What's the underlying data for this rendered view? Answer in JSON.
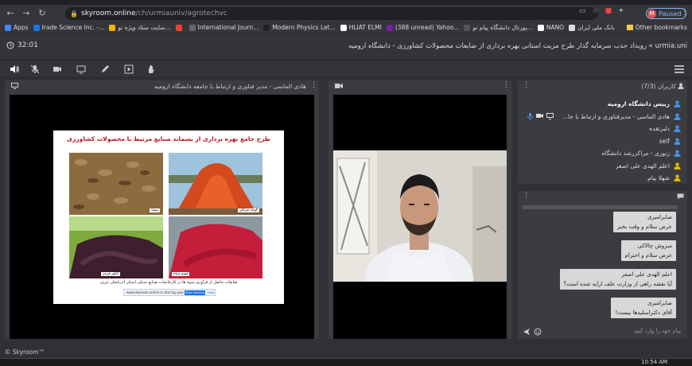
{
  "browser": {
    "url_host": "skyroom.online",
    "url_path": "/ch/urmiauniv/agrotechvc",
    "profile_initial": "M",
    "profile_label": "Paused"
  },
  "bookmarks": {
    "items": [
      {
        "label": "Apps",
        "color": "#4285f4"
      },
      {
        "label": "Irade Science Inc. -...",
        "color": "#1a73e8"
      },
      {
        "label": "سایت ستاد ویژه تو...",
        "color": "#f4b400"
      },
      {
        "label": "",
        "color": "#ea4335"
      },
      {
        "label": "International Journ...",
        "color": "#666"
      },
      {
        "label": "Modern Physics Let...",
        "color": "#222"
      },
      {
        "label": "HLIAT ELMI",
        "color": "#fff"
      },
      {
        "label": "(388 unread) Yahoo...",
        "color": "#7b1fa2"
      },
      {
        "label": "پورتال دانشگاه پیام نو...",
        "color": "#555"
      },
      {
        "label": "NANO",
        "color": "#fff"
      },
      {
        "label": "بانک ملی ایران",
        "color": "#ddd"
      }
    ],
    "other": "Other bookmarks"
  },
  "header": {
    "timer": "32:01",
    "title": "urmia.uni » رویداد جذب سرمایه گذار طرح مزیت استانی بهره برداری از ضایعات محصولات کشاورزی - دانشگاه ارومیه"
  },
  "main_panel": {
    "title": "هادی الماسی - مدیر فناوری و ارتباط با جامعه دانشگاه ارومیه",
    "slide": {
      "title": "طرح جامع بهره برداری از پسماند صنایع مرتبط با محصولات کشاورزی",
      "photos": [
        {
          "caption": "پسته"
        },
        {
          "caption": "گوجه فرنگی"
        },
        {
          "caption": "انگور قرمز"
        },
        {
          "caption": "فوتو سیاه"
        }
      ],
      "caption": "ضایعات حاصل از فرآوری میوه ها در کارخانجات صنایع تبدیلی استان آذربایجان غربی",
      "share_text": "www.skyroom.online is sharing your screen.",
      "share_button": "Stop sharing",
      "share_hide": "Hide"
    }
  },
  "users_panel": {
    "title": "کاربران (7/3)",
    "users": [
      {
        "name": "رییس دانشگاه ارومیه",
        "bold": true,
        "color": "#4a90e2"
      },
      {
        "name": "هادی الماسی - مدیرفناوری و ارتباط با جا...",
        "bold": false,
        "color": "#4a90e2"
      },
      {
        "name": "دلبرتقده",
        "bold": false,
        "color": "#4a90e2"
      },
      {
        "name": "seif",
        "bold": false,
        "color": "#4a90e2"
      },
      {
        "name": "زنوزی - مراکزرشد دانشگاه",
        "bold": false,
        "color": "#4a90e2"
      },
      {
        "name": "اعلم الهدی علی اصغر",
        "bold": false,
        "color": "#e6b800"
      },
      {
        "name": "شهلا پیام",
        "bold": false,
        "color": "#e6b800"
      }
    ]
  },
  "chat_panel": {
    "messages": [
      {
        "sender": "صابرامیری",
        "text": "عرض سلام و وقت بخیر"
      },
      {
        "sender": "سروش چالاکی",
        "text": "عرض سلام و احترام"
      },
      {
        "sender": "اعلم الهدی علی اصغر",
        "text": "آیا نقشه راهی از وزارت علف ارایه شده است؟"
      },
      {
        "sender": "صابرامیری",
        "text": "آقای دکتراسلیدها نیست!"
      }
    ],
    "input_placeholder": "پیام خود را وارد کنید"
  },
  "footer": {
    "brand": "© Skyroom™"
  },
  "taskbar": {
    "time": "10:54 AM"
  }
}
